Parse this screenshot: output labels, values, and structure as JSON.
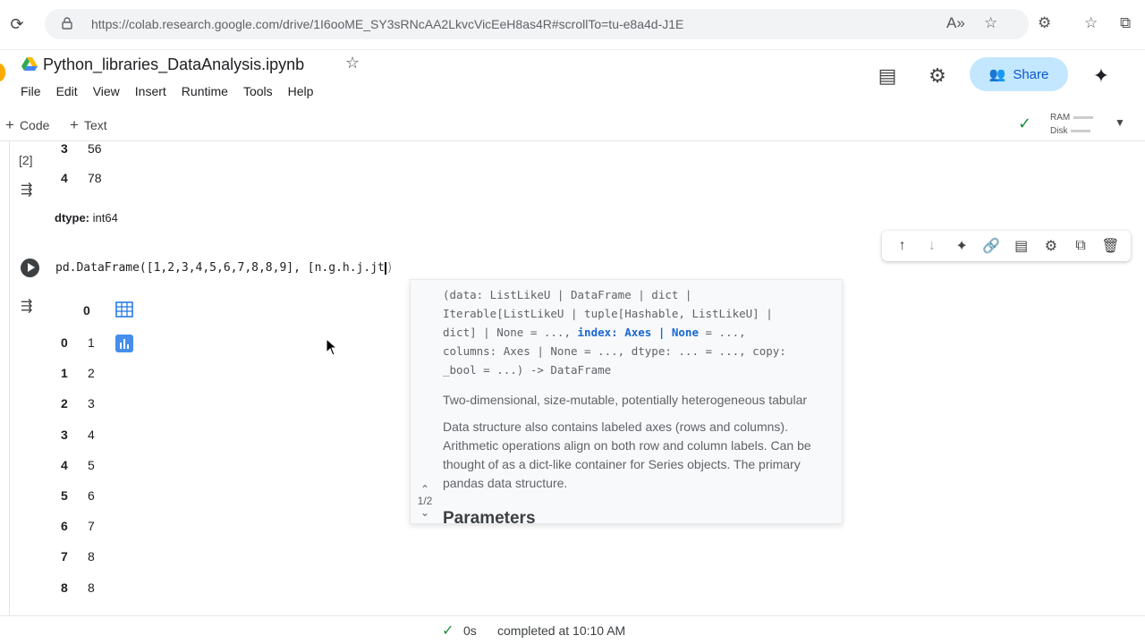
{
  "browser": {
    "url": "https://colab.research.google.com/drive/1I6ooME_SY3sRNcAA2LkvcVicEeH8as4R#scrollTo=tu-e8a4d-J1E"
  },
  "header": {
    "title": "Python_libraries_DataAnalysis.ipynb",
    "menu": [
      "File",
      "Edit",
      "View",
      "Insert",
      "Runtime",
      "Tools",
      "Help"
    ],
    "share_label": "Share"
  },
  "toolbar": {
    "code_label": "Code",
    "text_label": "Text",
    "ram_label": "RAM",
    "disk_label": "Disk"
  },
  "prev_output": {
    "cell_index": "[2]",
    "rows": [
      {
        "index": "3",
        "value": "56"
      },
      {
        "index": "4",
        "value": "78"
      }
    ],
    "dtype_label": "dtype:",
    "dtype_value": "int64"
  },
  "code_cell": {
    "code": "pd.DataFrame([1,2,3,4,5,6,7,8,8,9], [n.g.h.j.jt"
  },
  "dataframe_output": {
    "column_header": "0",
    "rows": [
      {
        "index": "0",
        "value": "1"
      },
      {
        "index": "1",
        "value": "2"
      },
      {
        "index": "2",
        "value": "3"
      },
      {
        "index": "3",
        "value": "4"
      },
      {
        "index": "4",
        "value": "5"
      },
      {
        "index": "5",
        "value": "6"
      },
      {
        "index": "6",
        "value": "7"
      },
      {
        "index": "7",
        "value": "8"
      },
      {
        "index": "8",
        "value": "8"
      }
    ]
  },
  "tooltip": {
    "sig_1": "(data: ListLikeU | DataFrame | dict |",
    "sig_2": "Iterable[ListLikeU | tuple[Hashable, ListLikeU] |",
    "sig_3a": "dict] | None = ..., ",
    "sig_3b": "index: Axes | None",
    "sig_3c": " = ...,",
    "sig_4": "columns: Axes | None = ..., dtype: ... = ..., copy:",
    "sig_5": "_bool = ...) -> DataFrame",
    "description": "Two-dimensional, size-mutable, potentially heterogeneous tabular",
    "details": [
      "Data structure also contains labeled axes (rows and columns).",
      "Arithmetic operations align on both row and column labels. Can be",
      "thought of as a dict-like container for Series objects. The primary",
      "pandas data structure."
    ],
    "parameters_heading": "Parameters",
    "pager": "1/2"
  },
  "status": {
    "duration": "0s",
    "completed": "completed at 10:10 AM"
  },
  "colors": {
    "share_bg": "#c2e7ff",
    "accent": "#1a73e8",
    "success": "#1e8e3e"
  }
}
